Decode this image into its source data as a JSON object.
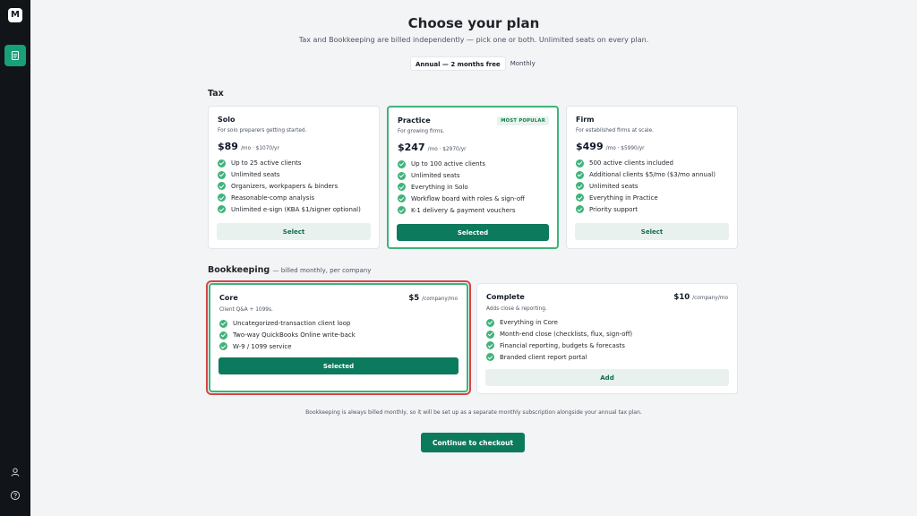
{
  "app": {
    "logo_text": "M"
  },
  "sidebar": {
    "icons": [
      "document-icon",
      "user-icon",
      "help-icon"
    ]
  },
  "header": {
    "title": "Choose your plan",
    "subtitle": "Tax and Bookkeeping are billed independently — pick one or both. Unlimited seats on every plan.",
    "billing_options": [
      {
        "label": "Annual — 2 months free",
        "active": true
      },
      {
        "label": "Monthly",
        "active": false
      }
    ]
  },
  "tax": {
    "title": "Tax",
    "plans": [
      {
        "name": "Solo",
        "description": "For solo preparers getting started.",
        "price": "$89",
        "price_detail": "/mo · $1070/yr",
        "features": [
          "Up to 25 active clients",
          "Unlimited seats",
          "Organizers, workpapers & binders",
          "Reasonable-comp analysis",
          "Unlimited e-sign (KBA $1/signer optional)"
        ],
        "button_label": "Select",
        "selected": false
      },
      {
        "name": "Practice",
        "badge": "MOST POPULAR",
        "description": "For growing firms.",
        "price": "$247",
        "price_detail": "/mo · $2970/yr",
        "features": [
          "Up to 100 active clients",
          "Unlimited seats",
          "Everything in Solo",
          "Workflow board with roles & sign-off",
          "K-1 delivery & payment vouchers"
        ],
        "button_label": "Selected",
        "selected": true
      },
      {
        "name": "Firm",
        "description": "For established firms at scale.",
        "price": "$499",
        "price_detail": "/mo · $5990/yr",
        "features": [
          "500 active clients included",
          "Additional clients $5/mo ($3/mo annual)",
          "Unlimited seats",
          "Everything in Practice",
          "Priority support"
        ],
        "button_label": "Select",
        "selected": false
      }
    ]
  },
  "bookkeeping": {
    "title": "Bookkeeping",
    "note": "— billed monthly, per company",
    "plans": [
      {
        "name": "Core",
        "description": "Client Q&A + 1099s.",
        "price": "$5",
        "price_detail": "/company/mo",
        "features": [
          "Uncategorized-transaction client loop",
          "Two-way QuickBooks Online write-back",
          "W-9 / 1099 service"
        ],
        "button_label": "Selected",
        "selected": true
      },
      {
        "name": "Complete",
        "description": "Adds close & reporting.",
        "price": "$10",
        "price_detail": "/company/mo",
        "features": [
          "Everything in Core",
          "Month-end close (checklists, flux, sign-off)",
          "Financial reporting, budgets & forecasts",
          "Branded client report portal"
        ],
        "button_label": "Add",
        "selected": false
      }
    ]
  },
  "footer": {
    "note": "Bookkeeping is always billed monthly, so it will be set up as a separate monthly subscription alongside your annual tax plan.",
    "checkout_label": "Continue to checkout"
  },
  "colors": {
    "sidebar_bg": "#111418",
    "accent": "#0c7a5c",
    "check": "#3fb37a",
    "selected_border": "#3fb37a",
    "focus_ring": "#d64545",
    "page_bg": "#f3f4f6"
  }
}
